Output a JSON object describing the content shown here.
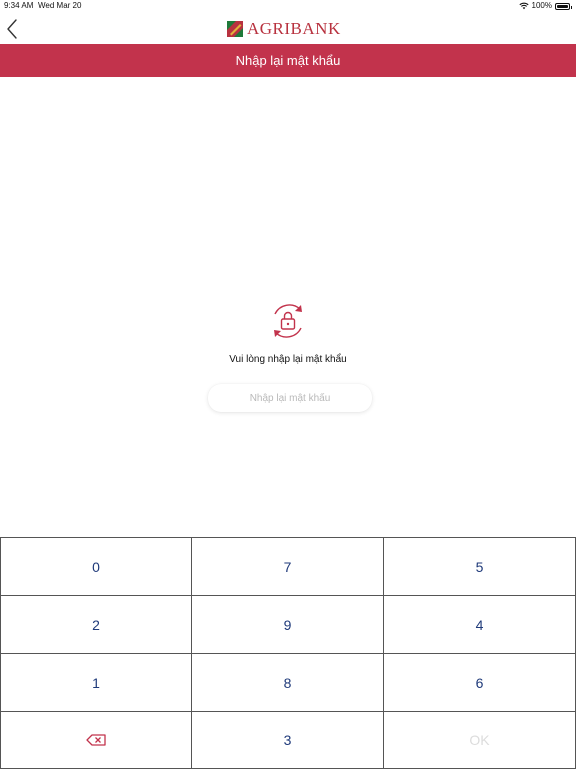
{
  "status": {
    "time": "9:34 AM",
    "date": "Wed Mar 20",
    "battery": "100%"
  },
  "header": {
    "brand": "AGRIBANK",
    "title": "Nhập lại mật khẩu",
    "brand_color": "#c2334c"
  },
  "main": {
    "prompt": "Vui lòng nhập lại mật khẩu",
    "input": {
      "value": "",
      "placeholder": "Nhập lại mật khẩu"
    },
    "icon": "lock-refresh-icon"
  },
  "keypad": {
    "keys": [
      "0",
      "7",
      "5",
      "2",
      "9",
      "4",
      "1",
      "8",
      "6",
      "backspace",
      "3",
      "OK"
    ]
  }
}
